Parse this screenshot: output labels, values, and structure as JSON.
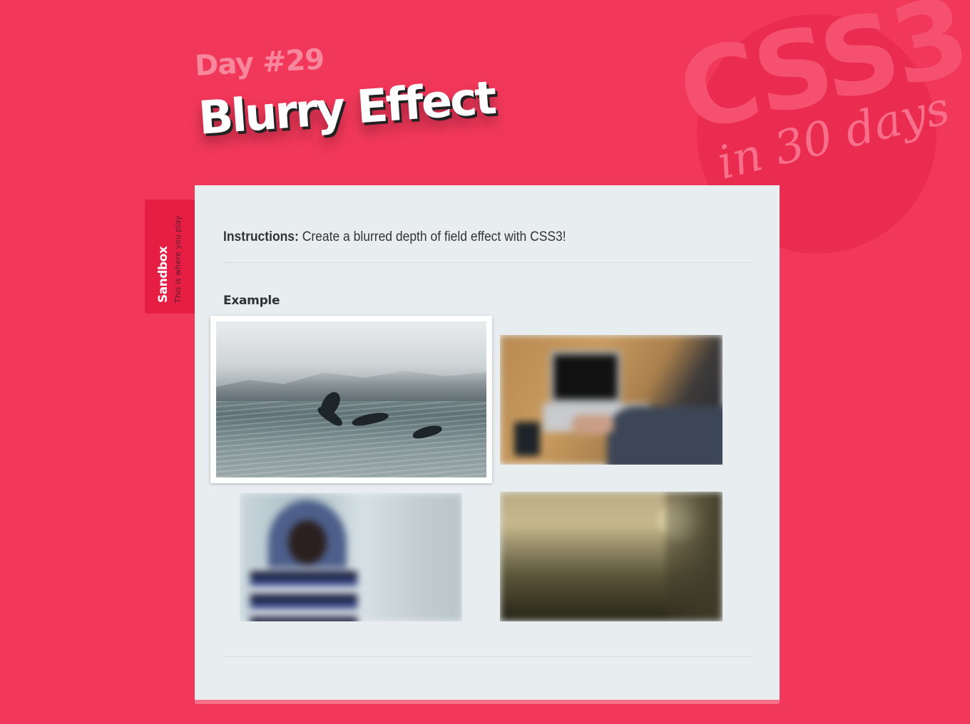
{
  "logo": {
    "main": "CSS3",
    "sub": "in 30 days"
  },
  "header": {
    "day": "Day #29",
    "title": "Blurry Effect"
  },
  "sandbox": {
    "title": "Sandbox",
    "subtitle": "This is where you play"
  },
  "panel": {
    "instructions_label": "Instructions:",
    "instructions_text": "Create a blurred depth of field effect with CSS3!",
    "example_heading": "Example"
  },
  "gallery": [
    {
      "subject": "dolphins jumping in the sea",
      "state": "focused"
    },
    {
      "subject": "person using a laptop",
      "state": "blurred"
    },
    {
      "subject": "girl in a hooded jacket",
      "state": "blurred"
    },
    {
      "subject": "landscape at sunset",
      "state": "blurred"
    }
  ],
  "colors": {
    "background": "#f2385a",
    "panel": "#e8edf0",
    "tab": "#e61e43",
    "title": "#ffffff",
    "day": "#f7879c"
  }
}
